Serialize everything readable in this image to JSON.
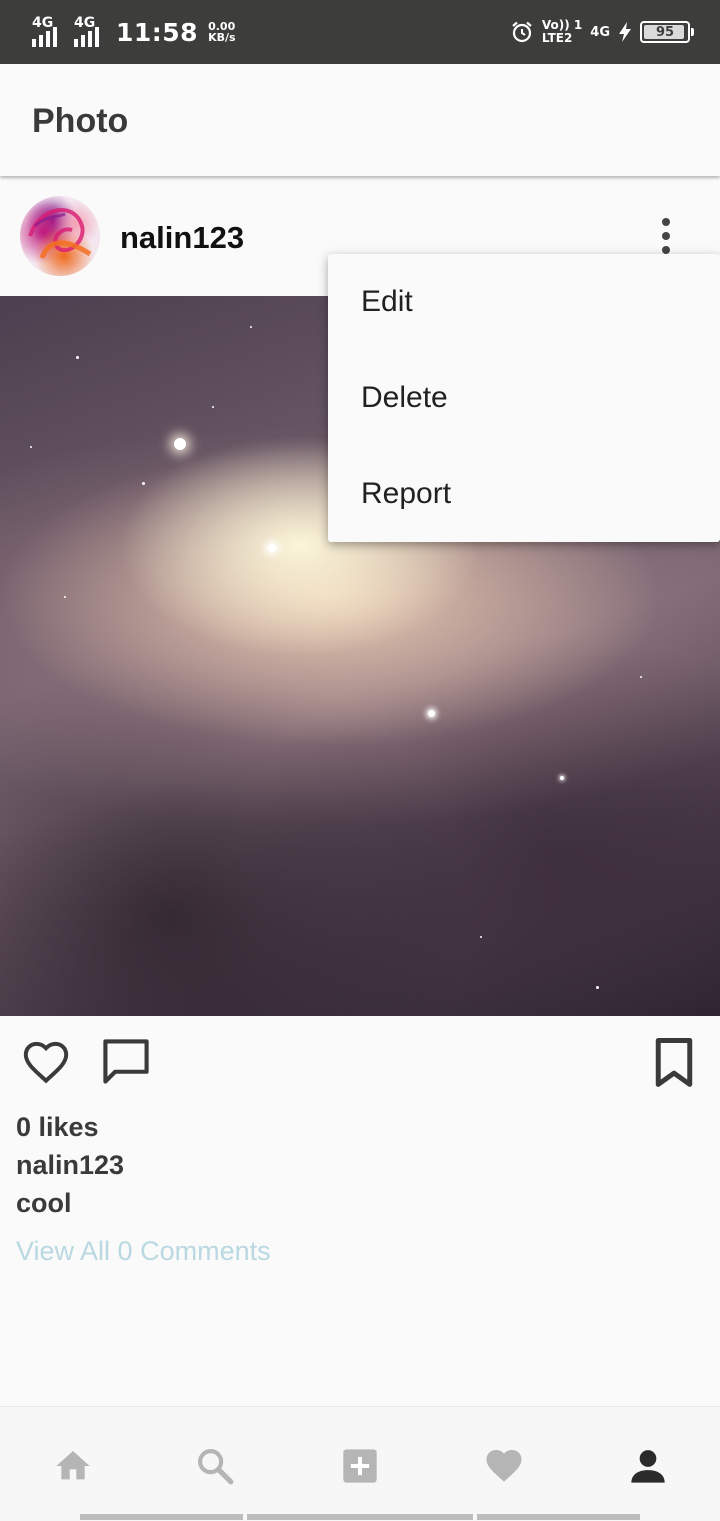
{
  "status_bar": {
    "signal1_label": "4G",
    "signal2_label": "4G",
    "time": "11:58",
    "speed_value": "0.00",
    "speed_unit": "KB/s",
    "volte_top": "Vo)) 1",
    "volte_bottom": "LTE2",
    "network": "4G",
    "battery": "95",
    "icons": [
      "alarm-icon",
      "charging-icon"
    ]
  },
  "app_bar": {
    "title": "Photo"
  },
  "post": {
    "username": "nalin123",
    "likes": "0 likes",
    "caption_user": "nalin123",
    "caption": "cool",
    "comments_link": "View All 0 Comments"
  },
  "menu": {
    "items": [
      {
        "label": "Edit"
      },
      {
        "label": "Delete"
      },
      {
        "label": "Report"
      }
    ]
  },
  "bottom_nav": {
    "items": [
      {
        "icon": "home-icon",
        "active": false
      },
      {
        "icon": "search-icon",
        "active": false
      },
      {
        "icon": "add-box-icon",
        "active": false
      },
      {
        "icon": "heart-icon",
        "active": false
      },
      {
        "icon": "person-icon",
        "active": true
      }
    ]
  },
  "colors": {
    "status_bar_bg": "#3d3d3b",
    "background": "#fafafa",
    "link": "#b9d8e1",
    "inactive_icon": "#b5b5b5",
    "active_icon": "#2b2b2b"
  }
}
